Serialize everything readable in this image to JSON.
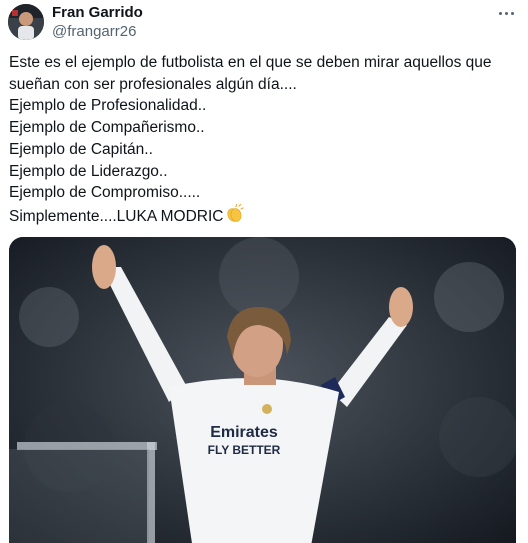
{
  "author": {
    "display_name": "Fran Garrido",
    "handle": "@frangarr26"
  },
  "tweet": {
    "lines": [
      "Este es el ejemplo de futbolista en el que se deben mirar aquellos que",
      "sueñan con ser profesionales algún día....",
      "Ejemplo de Profesionalidad..",
      "Ejemplo de Compañerismo..",
      "Ejemplo de Capitán..",
      "Ejemplo de Liderazgo..",
      "Ejemplo de Compromiso.....",
      "Simplemente....LUKA MODRIC"
    ],
    "emoji": "clapping-hands"
  },
  "media": {
    "shirt_sponsor_line1": "Emirates",
    "shirt_sponsor_line2": "FLY BETTER"
  },
  "icons": {
    "menu": "more-horizontal-icon"
  },
  "colors": {
    "text_primary": "#0f1419",
    "text_secondary": "#536471"
  }
}
